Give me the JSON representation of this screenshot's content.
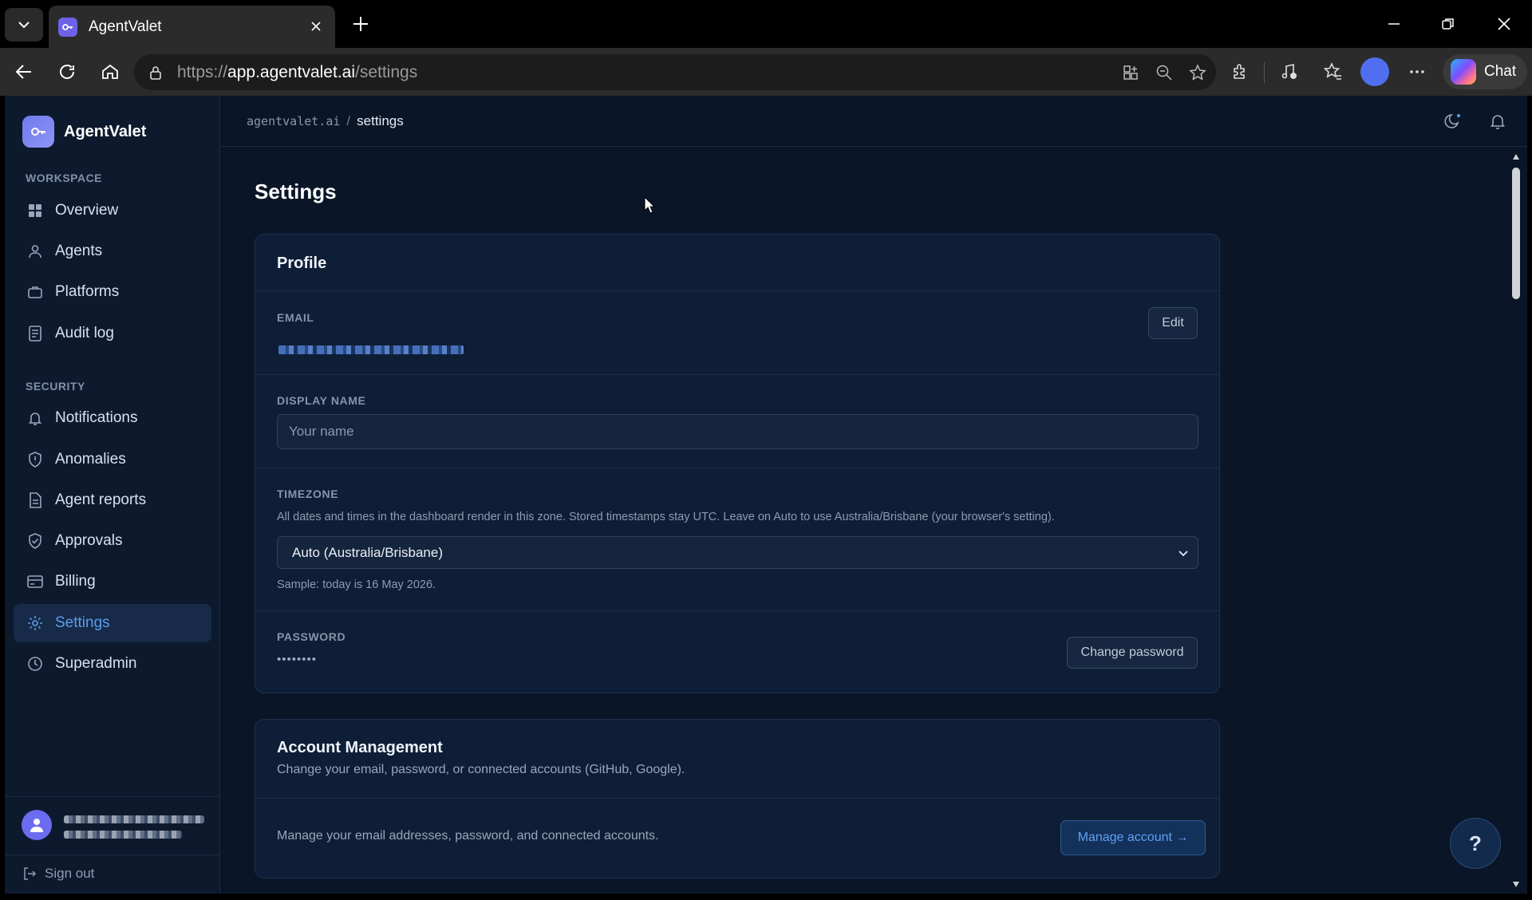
{
  "browser": {
    "tab_title": "AgentValet",
    "url_scheme": "https://",
    "url_host": "app.agentvalet.ai",
    "url_path": "/settings",
    "copilot_label": "Chat",
    "profile_color": "#4f6ff0"
  },
  "sidebar": {
    "brand": "AgentValet",
    "sections": {
      "workspace": "WORKSPACE",
      "security": "SECURITY"
    },
    "items": [
      {
        "label": "Overview",
        "icon": "grid-icon"
      },
      {
        "label": "Agents",
        "icon": "person-icon"
      },
      {
        "label": "Platforms",
        "icon": "briefcase-icon"
      },
      {
        "label": "Audit log",
        "icon": "document-icon"
      },
      {
        "label": "Notifications",
        "icon": "bell-icon"
      },
      {
        "label": "Anomalies",
        "icon": "shield-icon"
      },
      {
        "label": "Agent reports",
        "icon": "file-icon"
      },
      {
        "label": "Approvals",
        "icon": "shield-check-icon"
      },
      {
        "label": "Billing",
        "icon": "credit-card-icon"
      },
      {
        "label": "Settings",
        "icon": "gear-icon",
        "active": true
      },
      {
        "label": "Superadmin",
        "icon": "clock-icon"
      }
    ],
    "sign_out": "Sign out"
  },
  "header": {
    "crumb_root": "agentvalet.ai",
    "crumb_sep": "/",
    "crumb_current": "settings"
  },
  "page": {
    "title": "Settings"
  },
  "profile": {
    "title": "Profile",
    "email_label": "EMAIL",
    "edit_button": "Edit",
    "display_name_label": "DISPLAY NAME",
    "display_name_placeholder": "Your name",
    "timezone_label": "TIMEZONE",
    "timezone_help": "All dates and times in the dashboard render in this zone. Stored timestamps stay UTC. Leave on Auto to use Australia/Brisbane (your browser's setting).",
    "timezone_value": "Auto (Australia/Brisbane)",
    "timezone_sample": "Sample: today is 16 May 2026.",
    "password_label": "PASSWORD",
    "password_mask": "••••••••",
    "change_password_button": "Change password"
  },
  "account": {
    "title": "Account Management",
    "subtitle": "Change your email, password, or connected accounts (GitHub, Google).",
    "row_text": "Manage your email addresses, password, and connected accounts.",
    "manage_button": "Manage account →"
  },
  "help_button": "?",
  "colors": {
    "accent": "#5b9cf2",
    "background": "#0a1628",
    "card": "#0e1e36",
    "brand": "#6f7bf0"
  }
}
